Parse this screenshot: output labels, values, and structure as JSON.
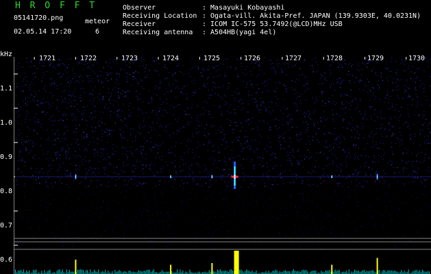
{
  "header": {
    "app_title": "H R O F F T",
    "filename": "05141720.png",
    "datetime": "02.05.14 17:20",
    "meteor_label": "meteor",
    "meteor_count": "6",
    "fields": [
      {
        "label": "Observer",
        "value": ": Masayuki Kobayashi"
      },
      {
        "label": "Receiving Location",
        "value": ": Ogata-vill. Akita-Pref. JAPAN (139.9303E, 40.0231N)"
      },
      {
        "label": "Receiver",
        "value": ": ICOM IC-575 53.7492(@LCD)MHz USB"
      },
      {
        "label": "Receiving antenna",
        "value": ": A504HB(yagi 4el)"
      }
    ]
  },
  "axis": {
    "y_unit": "kHz",
    "y_ticks": [
      "1.1",
      "1.0",
      "0.9",
      "0.8",
      "0.7",
      "0.6"
    ],
    "x_ticks": [
      "1721",
      "1722",
      "1723",
      "1724",
      "1725",
      "1726",
      "1727",
      "1728",
      "1729",
      "1730"
    ]
  },
  "colors": {
    "noise": "#1a1a8c",
    "accent_green": "#2bd92b",
    "baseline": "#00c8c8",
    "spike": "#ffff00",
    "meteor_core": "#ff3040"
  },
  "events": [
    {
      "time": "1722.0",
      "strength": 0.3
    },
    {
      "time": "1724.3",
      "strength": 0.15
    },
    {
      "time": "1725.3",
      "strength": 0.2
    },
    {
      "time": "1725.85",
      "strength": 1.0
    },
    {
      "time": "1728.2",
      "strength": 0.15
    },
    {
      "time": "1729.3",
      "strength": 0.35
    }
  ]
}
